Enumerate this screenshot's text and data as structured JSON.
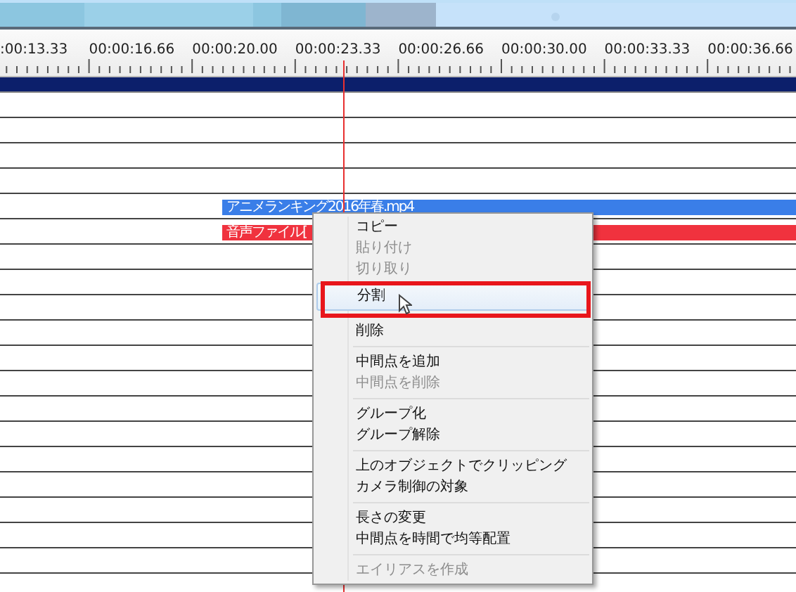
{
  "ruler": {
    "labels": [
      ":00:13.33",
      "00:00:16.66",
      "00:00:20.00",
      "00:00:23.33",
      "00:00:26.66",
      "00:00:30.00",
      "00:00:33.33",
      "00:00:36.66"
    ]
  },
  "clips": [
    {
      "label": "アニメランキング2016年春.mp4",
      "color": "#3a7ee8"
    },
    {
      "label": "音声ファイル[",
      "color": "#f0323e"
    }
  ],
  "context_menu": {
    "items": [
      {
        "kind": "item",
        "label": "コピー",
        "disabled": false,
        "selected": false
      },
      {
        "kind": "item",
        "label": "貼り付け",
        "disabled": true,
        "selected": false
      },
      {
        "kind": "item",
        "label": "切り取り",
        "disabled": true,
        "selected": false
      },
      {
        "kind": "item",
        "label": "分割",
        "disabled": false,
        "selected": true
      },
      {
        "kind": "separator"
      },
      {
        "kind": "item",
        "label": "削除",
        "disabled": false,
        "selected": false
      },
      {
        "kind": "separator"
      },
      {
        "kind": "item",
        "label": "中間点を追加",
        "disabled": false,
        "selected": false
      },
      {
        "kind": "item",
        "label": "中間点を削除",
        "disabled": true,
        "selected": false
      },
      {
        "kind": "separator"
      },
      {
        "kind": "item",
        "label": "グループ化",
        "disabled": false,
        "selected": false
      },
      {
        "kind": "item",
        "label": "グループ解除",
        "disabled": false,
        "selected": false
      },
      {
        "kind": "separator"
      },
      {
        "kind": "item",
        "label": "上のオブジェクトでクリッピング",
        "disabled": false,
        "selected": false
      },
      {
        "kind": "item",
        "label": "カメラ制御の対象",
        "disabled": false,
        "selected": false
      },
      {
        "kind": "separator"
      },
      {
        "kind": "item",
        "label": "長さの変更",
        "disabled": false,
        "selected": false
      },
      {
        "kind": "item",
        "label": "中間点を時間で均等配置",
        "disabled": false,
        "selected": false
      },
      {
        "kind": "separator"
      },
      {
        "kind": "item",
        "label": "エイリアスを作成",
        "disabled": true,
        "selected": false
      }
    ]
  }
}
